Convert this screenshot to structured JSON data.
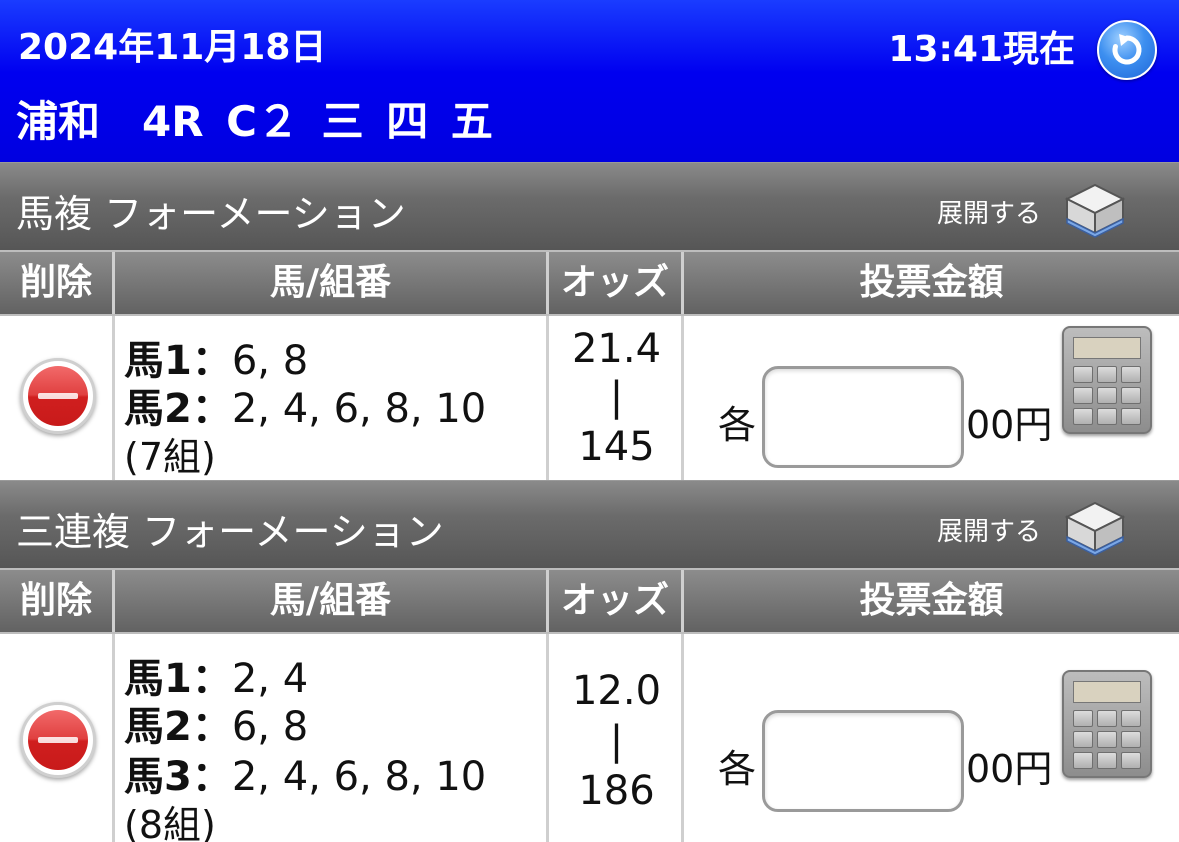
{
  "header": {
    "date": "2024年11月18日",
    "time": "13:41現在",
    "race": "浦和　4R C２ 三 四 五"
  },
  "columns": {
    "delete": "削除",
    "number": "馬/組番",
    "odds": "オッズ",
    "amount": "投票金額"
  },
  "bets": [
    {
      "title": "馬複 フォーメーション",
      "expand_label": "展開する",
      "lines": [
        {
          "label": "馬1：",
          "value": "6, 8"
        },
        {
          "label": "馬2：",
          "value": "2, 4, 6, 8, 10"
        }
      ],
      "combo": "(7組)",
      "odds_low": "21.4",
      "odds_sep": "|",
      "odds_high": "145",
      "each_label": "各",
      "amount_value": "",
      "unit": "00円"
    },
    {
      "title": "三連複 フォーメーション",
      "expand_label": "展開する",
      "lines": [
        {
          "label": "馬1：",
          "value": "2, 4"
        },
        {
          "label": "馬2：",
          "value": "6, 8"
        },
        {
          "label": "馬3：",
          "value": "2, 4, 6, 8, 10"
        }
      ],
      "combo": "(8組)",
      "odds_low": "12.0",
      "odds_sep": "|",
      "odds_high": "186",
      "each_label": "各",
      "amount_value": "",
      "unit": "00円"
    }
  ],
  "icons": {
    "refresh": "refresh-icon",
    "expand": "box-icon",
    "delete": "delete-icon",
    "calculator": "calculator-icon"
  },
  "colors": {
    "header": "#0000e8",
    "section": "#666666",
    "delete": "#d92a2a"
  }
}
